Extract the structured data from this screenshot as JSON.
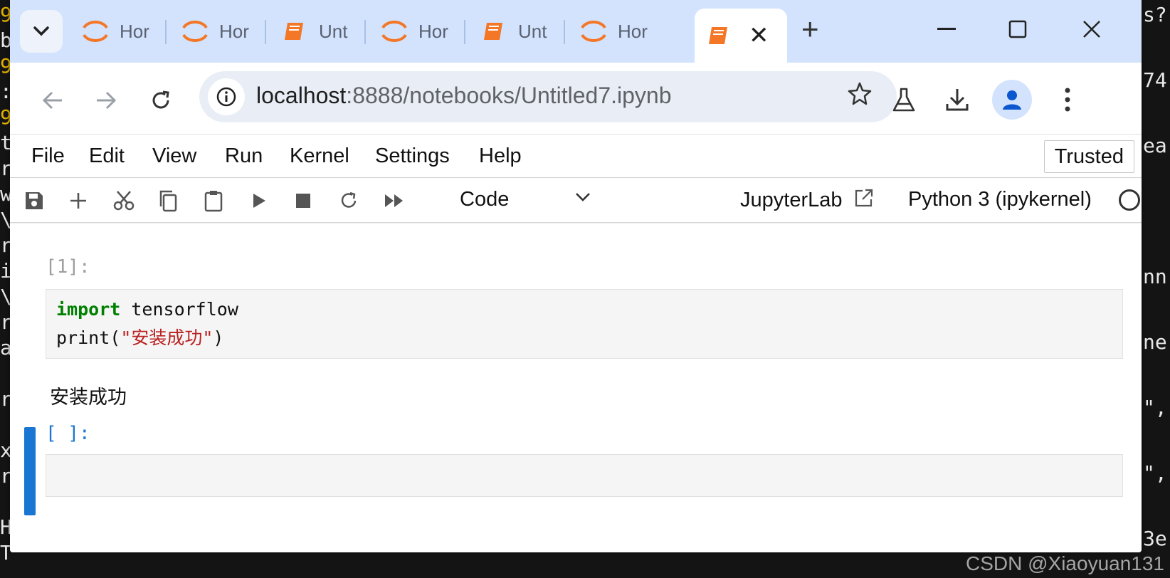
{
  "background_terminal": {
    "left_chars": [
      "9",
      "b",
      "9",
      ":",
      "9",
      "t",
      "r",
      "w",
      "\\",
      "r",
      "i",
      "\\",
      "r",
      "a",
      "",
      "r",
      "",
      "x",
      "r",
      "",
      "H",
      "T"
    ],
    "right_lines": [
      "s?",
      "",
      "74",
      "",
      "ea",
      "",
      "",
      "",
      "nn",
      "",
      "ne",
      "",
      "\",",
      "",
      "\",",
      "",
      "3e"
    ]
  },
  "browser": {
    "tabs": [
      {
        "label": "Hor",
        "icon": "jupyter-icon"
      },
      {
        "label": "Hor",
        "icon": "jupyter-icon"
      },
      {
        "label": "Unt",
        "icon": "notebook-icon"
      },
      {
        "label": "Hor",
        "icon": "jupyter-icon"
      },
      {
        "label": "Unt",
        "icon": "notebook-icon"
      },
      {
        "label": "Hor",
        "icon": "jupyter-icon"
      }
    ],
    "active_tab": {
      "icon": "notebook-icon"
    },
    "url_host": "localhost",
    "url_rest": ":8888/notebooks/Untitled7.ipynb"
  },
  "jupyter": {
    "menu": [
      "File",
      "Edit",
      "View",
      "Run",
      "Kernel",
      "Settings",
      "Help"
    ],
    "trusted": "Trusted",
    "cell_type": "Code",
    "jupyterlab_link": "JupyterLab",
    "kernel_name": "Python 3 (ipykernel)",
    "cells": [
      {
        "prompt": "[1]:",
        "code_line1_kw": "import",
        "code_line1_rest": " tensorflow",
        "code_line2_pre": "print(",
        "code_line2_str": "\"安装成功\"",
        "code_line2_post": ")",
        "output": "安装成功"
      },
      {
        "prompt": "[ ]:"
      }
    ]
  },
  "watermark": "CSDN @Xiaoyuan131",
  "colors": {
    "tab_strip": "#d3e3fd",
    "jupyter_orange": "#f37726",
    "active_cell": "#1976d2",
    "keyword": "#008000",
    "string": "#ba2121"
  }
}
